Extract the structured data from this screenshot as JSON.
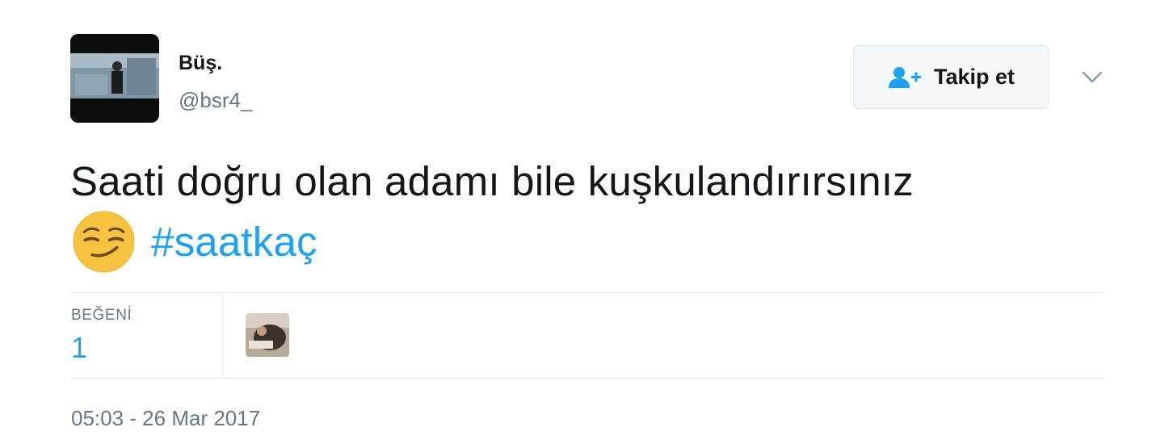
{
  "user": {
    "display_name": "Büş.",
    "handle": "@bsr4_",
    "avatar_icon": "profile-photo"
  },
  "follow_button": {
    "label": "Takip et",
    "icon": "follow-user-icon"
  },
  "menu_icon": "chevron-down-icon",
  "tweet": {
    "text": "Saati doğru olan adamı bile kuşkulandırırsınız",
    "emoji_icon": "smirking-face-emoji",
    "hashtag": "#saatkaç"
  },
  "stats": {
    "likes_label": "BEĞENİ",
    "likes_count": "1"
  },
  "timestamp": "05:03 - 26 Mar 2017",
  "colors": {
    "link": "#1da1f2",
    "secondary_text": "#657786",
    "primary_text": "#14171a",
    "border": "#e6ecf0"
  }
}
